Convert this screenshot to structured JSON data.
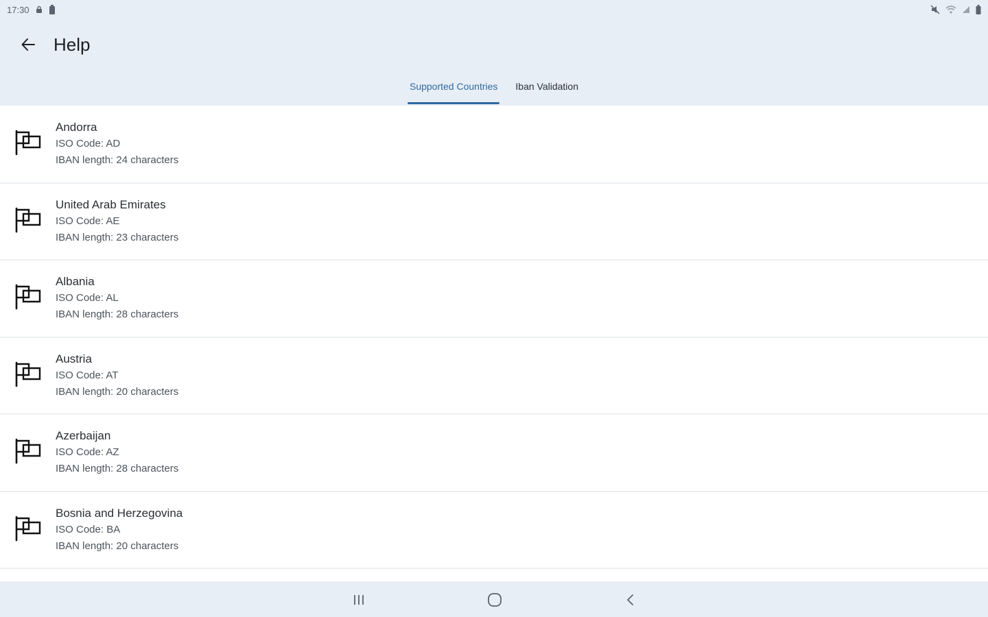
{
  "status_bar": {
    "time": "17:30"
  },
  "app_bar": {
    "title": "Help",
    "back_icon": "arrow-back-icon"
  },
  "tabs": [
    {
      "label": "Supported Countries",
      "active": true
    },
    {
      "label": "Iban Validation",
      "active": false
    }
  ],
  "countries": [
    {
      "name": "Andorra",
      "iso": "ISO Code: AD",
      "iban": "IBAN length: 24 characters"
    },
    {
      "name": "United Arab Emirates",
      "iso": "ISO Code: AE",
      "iban": "IBAN length: 23 characters"
    },
    {
      "name": "Albania",
      "iso": "ISO Code: AL",
      "iban": "IBAN length: 28 characters"
    },
    {
      "name": "Austria",
      "iso": "ISO Code: AT",
      "iban": "IBAN length: 20 characters"
    },
    {
      "name": "Azerbaijan",
      "iso": "ISO Code: AZ",
      "iban": "IBAN length: 28 characters"
    },
    {
      "name": "Bosnia and Herzegovina",
      "iso": "ISO Code: BA",
      "iban": "IBAN length: 20 characters"
    }
  ],
  "colors": {
    "bar_background": "#e8eef5",
    "accent": "#2f6aa3"
  }
}
